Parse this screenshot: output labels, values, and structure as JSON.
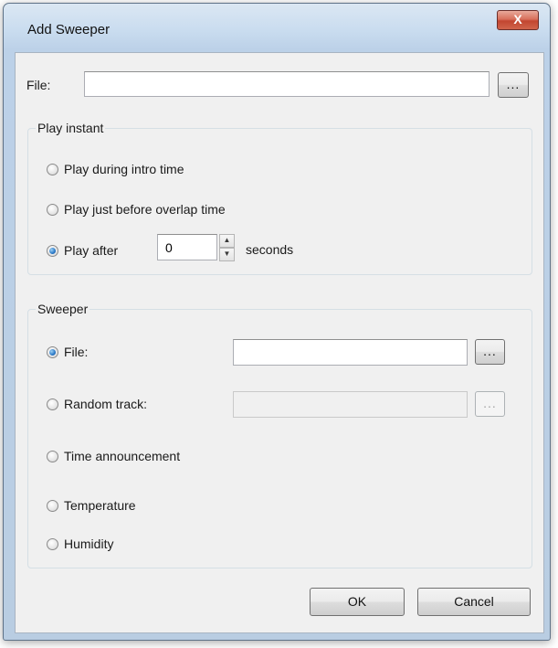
{
  "window": {
    "title": "Add Sweeper",
    "close_glyph": "X"
  },
  "file": {
    "label": "File:",
    "value": "",
    "browse_label": "..."
  },
  "play_instant": {
    "group_title": "Play instant",
    "options": [
      {
        "label": "Play during intro time",
        "checked": false
      },
      {
        "label": "Play just before overlap time",
        "checked": false
      },
      {
        "label": "Play after",
        "checked": true
      }
    ],
    "play_after_value": "0",
    "seconds_label": "seconds"
  },
  "sweeper": {
    "group_title": "Sweeper",
    "file": {
      "label": "File:",
      "checked": true,
      "value": "",
      "browse_label": "..."
    },
    "random_track": {
      "label": "Random track:",
      "checked": false,
      "value": "",
      "browse_label": "..."
    },
    "time_announcement": {
      "label": "Time announcement",
      "checked": false
    },
    "temperature": {
      "label": "Temperature",
      "checked": false
    },
    "humidity": {
      "label": "Humidity",
      "checked": false
    }
  },
  "buttons": {
    "ok": "OK",
    "cancel": "Cancel"
  },
  "icons": {
    "close": "close-icon",
    "spin_up": "arrow-up-icon",
    "spin_down": "arrow-down-icon"
  },
  "colors": {
    "close_button": "#c24631",
    "radio_checked": "#2a78c6",
    "frame": "#bcd1e8"
  }
}
